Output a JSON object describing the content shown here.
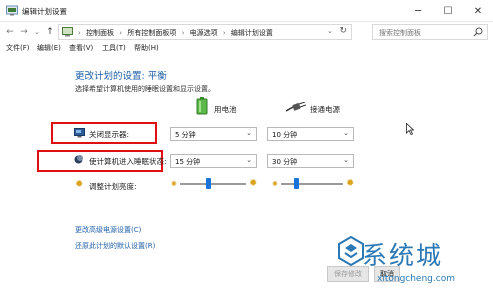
{
  "window": {
    "title": "编辑计划设置",
    "minimize_glyph": "─",
    "maximize_glyph": "☐",
    "close_glyph": "✕"
  },
  "address": {
    "crumbs": [
      "控制面板",
      "所有控制面板项",
      "电源选项",
      "编辑计划设置"
    ],
    "search_placeholder": "搜索控制面板"
  },
  "menu": [
    "文件(F)",
    "编辑(E)",
    "查看(V)",
    "工具(T)",
    "帮助(H)"
  ],
  "page": {
    "heading": "更改计划的设置: 平衡",
    "description": "选择希望计算机使用的睡眠设置和显示设置。",
    "columns": {
      "battery": "用电池",
      "plugged": "接通电源"
    }
  },
  "settings": [
    {
      "label": "关闭显示器:",
      "battery": "5 分钟",
      "plugged": "10 分钟"
    },
    {
      "label": "使计算机进入睡眠状态:",
      "battery": "15 分钟",
      "plugged": "30 分钟"
    }
  ],
  "brightness": {
    "label": "调整计划亮度:",
    "battery_level": 0.42,
    "plugged_level": 0.22
  },
  "links": {
    "advanced": "更改高级电源设置(C)",
    "restore": "还原此计划的默认设置(R)"
  },
  "buttons": {
    "save": "保存修改",
    "cancel": "取消"
  },
  "watermark": {
    "brand": "系统城",
    "url": "xitongcheng.com"
  },
  "colors": {
    "accent": "#1e5fa8",
    "highlight_box": "#e01010",
    "slider_thumb": "#1a73d9"
  }
}
